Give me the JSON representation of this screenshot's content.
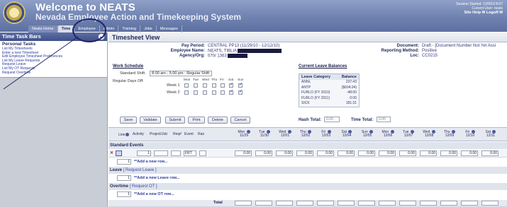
{
  "header": {
    "title": "Welcome to NEATS",
    "subtitle": "Nevada Employee Action and Timekeeping System",
    "session_started": "Session Started: 12/9/10 8:07",
    "current_user": "Current User: neats",
    "links": "Site Help ✉  Logoff ✉"
  },
  "nav": [
    "Neats Home",
    "Time",
    "Employee",
    "Admin",
    "Training",
    "Jobs",
    "Messages"
  ],
  "sidebar": {
    "title": "Time Task Bars",
    "section": "Personal Tasks",
    "links": [
      "List My Timesheets",
      "Enter a new Timesheet",
      "Edit Employee Timesheet Preferences",
      "List My Leave Requests",
      "Request Leave",
      "List My OT Requests",
      "Request Overtime"
    ]
  },
  "main": {
    "view_title": "Timesheet View",
    "pay_period_label": "Pay Period:",
    "pay_period_value": "CENTRAL PP13 (11/29/10 - 12/12/10)",
    "employee_name_label": "Employee Name:",
    "employee_name_value": "NEATS, TIBLIA",
    "agency_label": "Agency/Org:",
    "agency_value": "070/ 1363",
    "document_label": "Document:",
    "document_value": "Draft - [Document Number Not Yet Assi",
    "reporting_label": "Reporting Method:",
    "reporting_value": "Positive",
    "loc_label": "Loc:",
    "loc_value": "CC0215"
  },
  "schedule": {
    "title": "Work Schedule",
    "standard_shift_label": "Standard Shift:",
    "standard_shift_value": "8:00 am - 5:00 pm : Regular Shift",
    "regular_days_label": "Regular Days Off:",
    "days": [
      "Mon",
      "Tue",
      "Wed",
      "Thu",
      "Fri",
      "Sat",
      "Sun"
    ],
    "week1_label": "Week 1",
    "week2_label": "Week 2",
    "week1_checked": [
      false,
      false,
      false,
      false,
      false,
      true,
      true
    ],
    "week2_checked": [
      false,
      false,
      false,
      false,
      false,
      true,
      true
    ]
  },
  "leave_balances": {
    "title": "Current Leave Balances",
    "col_category": "Leave Category",
    "col_balance": "Balance",
    "rows": [
      {
        "category": "ANNL",
        "balance": "237:43"
      },
      {
        "category": "ANTP",
        "balance": "($604.04)"
      },
      {
        "category": "FURLO (FY 2010)",
        "balance": "-48:00"
      },
      {
        "category": "FURLO (FY 2011)",
        "balance": "0:00"
      },
      {
        "category": "SICK",
        "balance": "181:31"
      }
    ]
  },
  "actions": {
    "buttons": [
      "Save",
      "Validate",
      "Submit",
      "Print",
      "Delete",
      "Cancel"
    ],
    "hash_total_label": "Hash Total:",
    "hash_total_value": "0.00",
    "time_total_label": "Time Total:",
    "time_total_value": "0.00"
  },
  "grid": {
    "columns": [
      "Line",
      "Activity",
      "Project/Job",
      "Req#",
      "Event",
      "Ran"
    ],
    "dates": [
      {
        "day": "Mon",
        "date": "11/29"
      },
      {
        "day": "Tue",
        "date": "11/30"
      },
      {
        "day": "Wed",
        "date": "12/01"
      },
      {
        "day": "Thu",
        "date": "12/02"
      },
      {
        "day": "Fri",
        "date": "12/03"
      },
      {
        "day": "Sat",
        "date": "12/04"
      },
      {
        "day": "Sun",
        "date": "12/05"
      },
      {
        "day": "Mon",
        "date": "12/06"
      },
      {
        "day": "Tue",
        "date": "12/07"
      },
      {
        "day": "Wed",
        "date": "12/08"
      },
      {
        "day": "Thu",
        "date": "12/09"
      },
      {
        "day": "Fri",
        "date": "12/10"
      },
      {
        "day": "Sat",
        "date": "12/11"
      }
    ],
    "standard_events_label": "Standard Events",
    "std_row": {
      "line": "1",
      "event": "FRT",
      "hours": [
        "0.00",
        "0.00",
        "0.00",
        "0.00",
        "0.00",
        "0.00",
        "0.00",
        "0.00",
        "0.00",
        "0.00",
        "0.00",
        "0.00",
        "0.00"
      ]
    },
    "add_row_index": "1",
    "add_new_row": "**Add a new row...",
    "leave_label": "Leave",
    "request_leave": "[ Request Leave ]",
    "add_leave_row": "**Add a new Leave row...",
    "overtime_label": "Overtime",
    "request_ot": "[ Request OT ]",
    "add_ot_row": "**Add a new OT row...",
    "total_label": "Total"
  }
}
